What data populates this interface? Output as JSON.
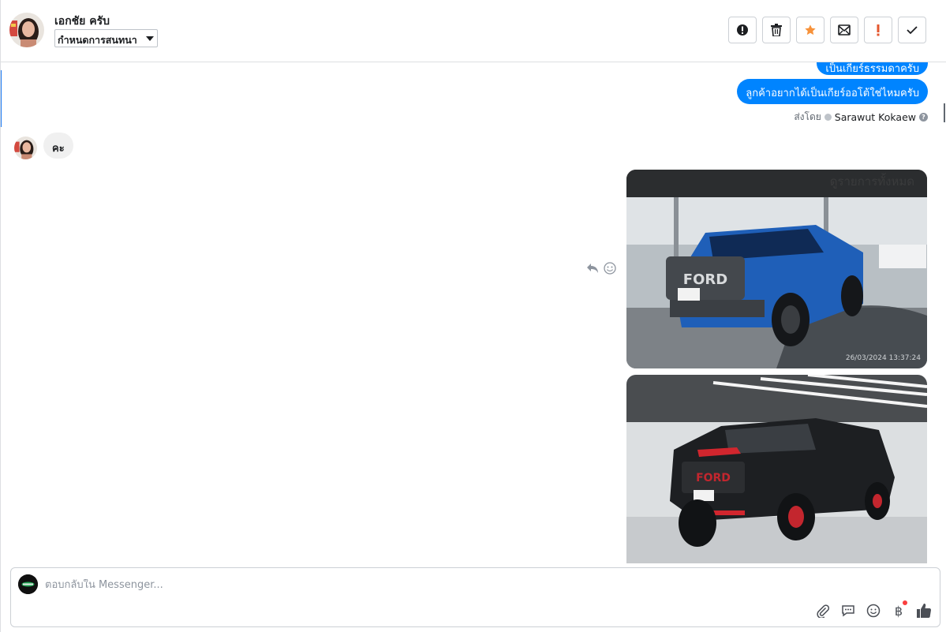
{
  "header": {
    "contact_name": "เอกชัย ครับ",
    "label_select_value": "กำหนดการสนทนา",
    "toolbar": [
      {
        "icon": "spam-icon"
      },
      {
        "icon": "trash-icon"
      },
      {
        "icon": "star-icon"
      },
      {
        "icon": "mark-unread-icon"
      },
      {
        "icon": "follow-up-icon"
      },
      {
        "icon": "done-check-icon"
      }
    ]
  },
  "thread": {
    "messages_out": [
      {
        "text": "เป็นเกียร์ธรรมดาครับ"
      },
      {
        "text": "ลูกค้าอยากได้เป็นเกียร์ออโต้ใช่ไหมครับ"
      }
    ],
    "sent_by_prefix": "ส่งโดย",
    "sent_by_name": "Sarawut Kokaew",
    "help_glyph": "?",
    "message_in": "คะ",
    "image_card_banner": "ดูรายการทั้งหมด",
    "image1_timestamp": "26/03/2024 13:37:24"
  },
  "composer": {
    "placeholder": "ตอบกลับใน Messenger...",
    "value": "",
    "baht_glyph": "฿"
  },
  "colors": {
    "accent": "#0084ff",
    "star": "#f7923a",
    "alert": "#e4572e",
    "notify_dot": "#fa3e3e"
  }
}
